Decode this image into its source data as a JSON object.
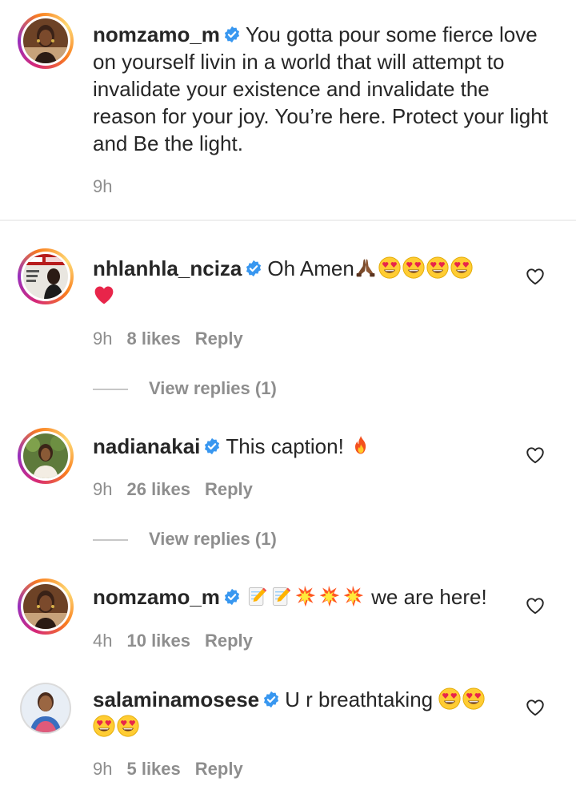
{
  "caption": {
    "username": "nomzamo_m",
    "text_line1": "You gotta pour some fierce",
    "text_rest": "love on yourself livin in a world that will attempt to invalidate your existence and invalidate the reason for your joy. You’re here. Protect your light and Be the light.",
    "time": "9h"
  },
  "comments": [
    {
      "username": "nhlanhla_nciza",
      "text": "Oh Amen",
      "time": "9h",
      "likes": "8 likes",
      "reply_label": "Reply",
      "view_replies": "View replies (1)"
    },
    {
      "username": "nadianakai",
      "text": "This caption!",
      "time": "9h",
      "likes": "26 likes",
      "reply_label": "Reply",
      "view_replies": "View replies (1)"
    },
    {
      "username": "nomzamo_m",
      "text": "we are here!",
      "time": "4h",
      "likes": "10 likes",
      "reply_label": "Reply"
    },
    {
      "username": "salaminamosese",
      "text": "U r breathtaking",
      "time": "9h",
      "likes": "5 likes",
      "reply_label": "Reply"
    }
  ],
  "icons": {
    "verified": "verified-badge-icon",
    "like": "heart-outline-icon"
  },
  "colors": {
    "verified_blue": "#3897f0",
    "meta_gray": "#8e8e8e",
    "text": "#262626"
  }
}
